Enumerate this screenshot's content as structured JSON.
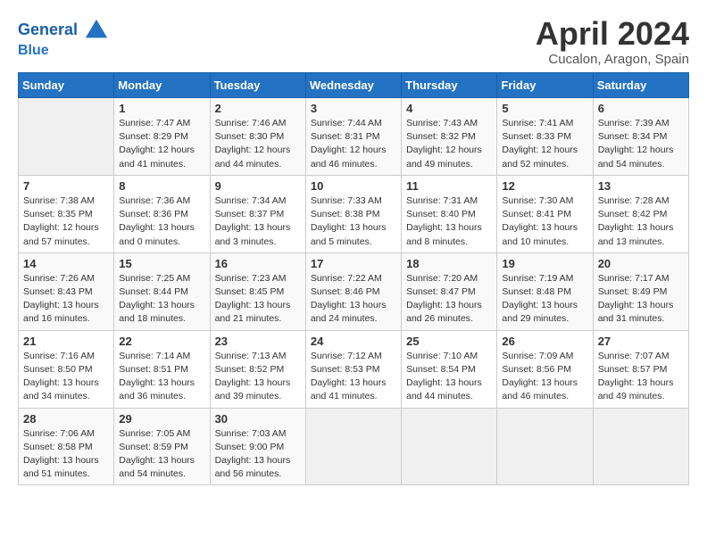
{
  "header": {
    "logo_line1": "General",
    "logo_line2": "Blue",
    "month_title": "April 2024",
    "location": "Cucalon, Aragon, Spain"
  },
  "weekdays": [
    "Sunday",
    "Monday",
    "Tuesday",
    "Wednesday",
    "Thursday",
    "Friday",
    "Saturday"
  ],
  "weeks": [
    [
      {
        "day": "",
        "empty": true
      },
      {
        "day": "1",
        "sunrise": "Sunrise: 7:47 AM",
        "sunset": "Sunset: 8:29 PM",
        "daylight": "Daylight: 12 hours and 41 minutes."
      },
      {
        "day": "2",
        "sunrise": "Sunrise: 7:46 AM",
        "sunset": "Sunset: 8:30 PM",
        "daylight": "Daylight: 12 hours and 44 minutes."
      },
      {
        "day": "3",
        "sunrise": "Sunrise: 7:44 AM",
        "sunset": "Sunset: 8:31 PM",
        "daylight": "Daylight: 12 hours and 46 minutes."
      },
      {
        "day": "4",
        "sunrise": "Sunrise: 7:43 AM",
        "sunset": "Sunset: 8:32 PM",
        "daylight": "Daylight: 12 hours and 49 minutes."
      },
      {
        "day": "5",
        "sunrise": "Sunrise: 7:41 AM",
        "sunset": "Sunset: 8:33 PM",
        "daylight": "Daylight: 12 hours and 52 minutes."
      },
      {
        "day": "6",
        "sunrise": "Sunrise: 7:39 AM",
        "sunset": "Sunset: 8:34 PM",
        "daylight": "Daylight: 12 hours and 54 minutes."
      }
    ],
    [
      {
        "day": "7",
        "sunrise": "Sunrise: 7:38 AM",
        "sunset": "Sunset: 8:35 PM",
        "daylight": "Daylight: 12 hours and 57 minutes."
      },
      {
        "day": "8",
        "sunrise": "Sunrise: 7:36 AM",
        "sunset": "Sunset: 8:36 PM",
        "daylight": "Daylight: 13 hours and 0 minutes."
      },
      {
        "day": "9",
        "sunrise": "Sunrise: 7:34 AM",
        "sunset": "Sunset: 8:37 PM",
        "daylight": "Daylight: 13 hours and 3 minutes."
      },
      {
        "day": "10",
        "sunrise": "Sunrise: 7:33 AM",
        "sunset": "Sunset: 8:38 PM",
        "daylight": "Daylight: 13 hours and 5 minutes."
      },
      {
        "day": "11",
        "sunrise": "Sunrise: 7:31 AM",
        "sunset": "Sunset: 8:40 PM",
        "daylight": "Daylight: 13 hours and 8 minutes."
      },
      {
        "day": "12",
        "sunrise": "Sunrise: 7:30 AM",
        "sunset": "Sunset: 8:41 PM",
        "daylight": "Daylight: 13 hours and 10 minutes."
      },
      {
        "day": "13",
        "sunrise": "Sunrise: 7:28 AM",
        "sunset": "Sunset: 8:42 PM",
        "daylight": "Daylight: 13 hours and 13 minutes."
      }
    ],
    [
      {
        "day": "14",
        "sunrise": "Sunrise: 7:26 AM",
        "sunset": "Sunset: 8:43 PM",
        "daylight": "Daylight: 13 hours and 16 minutes."
      },
      {
        "day": "15",
        "sunrise": "Sunrise: 7:25 AM",
        "sunset": "Sunset: 8:44 PM",
        "daylight": "Daylight: 13 hours and 18 minutes."
      },
      {
        "day": "16",
        "sunrise": "Sunrise: 7:23 AM",
        "sunset": "Sunset: 8:45 PM",
        "daylight": "Daylight: 13 hours and 21 minutes."
      },
      {
        "day": "17",
        "sunrise": "Sunrise: 7:22 AM",
        "sunset": "Sunset: 8:46 PM",
        "daylight": "Daylight: 13 hours and 24 minutes."
      },
      {
        "day": "18",
        "sunrise": "Sunrise: 7:20 AM",
        "sunset": "Sunset: 8:47 PM",
        "daylight": "Daylight: 13 hours and 26 minutes."
      },
      {
        "day": "19",
        "sunrise": "Sunrise: 7:19 AM",
        "sunset": "Sunset: 8:48 PM",
        "daylight": "Daylight: 13 hours and 29 minutes."
      },
      {
        "day": "20",
        "sunrise": "Sunrise: 7:17 AM",
        "sunset": "Sunset: 8:49 PM",
        "daylight": "Daylight: 13 hours and 31 minutes."
      }
    ],
    [
      {
        "day": "21",
        "sunrise": "Sunrise: 7:16 AM",
        "sunset": "Sunset: 8:50 PM",
        "daylight": "Daylight: 13 hours and 34 minutes."
      },
      {
        "day": "22",
        "sunrise": "Sunrise: 7:14 AM",
        "sunset": "Sunset: 8:51 PM",
        "daylight": "Daylight: 13 hours and 36 minutes."
      },
      {
        "day": "23",
        "sunrise": "Sunrise: 7:13 AM",
        "sunset": "Sunset: 8:52 PM",
        "daylight": "Daylight: 13 hours and 39 minutes."
      },
      {
        "day": "24",
        "sunrise": "Sunrise: 7:12 AM",
        "sunset": "Sunset: 8:53 PM",
        "daylight": "Daylight: 13 hours and 41 minutes."
      },
      {
        "day": "25",
        "sunrise": "Sunrise: 7:10 AM",
        "sunset": "Sunset: 8:54 PM",
        "daylight": "Daylight: 13 hours and 44 minutes."
      },
      {
        "day": "26",
        "sunrise": "Sunrise: 7:09 AM",
        "sunset": "Sunset: 8:56 PM",
        "daylight": "Daylight: 13 hours and 46 minutes."
      },
      {
        "day": "27",
        "sunrise": "Sunrise: 7:07 AM",
        "sunset": "Sunset: 8:57 PM",
        "daylight": "Daylight: 13 hours and 49 minutes."
      }
    ],
    [
      {
        "day": "28",
        "sunrise": "Sunrise: 7:06 AM",
        "sunset": "Sunset: 8:58 PM",
        "daylight": "Daylight: 13 hours and 51 minutes."
      },
      {
        "day": "29",
        "sunrise": "Sunrise: 7:05 AM",
        "sunset": "Sunset: 8:59 PM",
        "daylight": "Daylight: 13 hours and 54 minutes."
      },
      {
        "day": "30",
        "sunrise": "Sunrise: 7:03 AM",
        "sunset": "Sunset: 9:00 PM",
        "daylight": "Daylight: 13 hours and 56 minutes."
      },
      {
        "day": "",
        "empty": true
      },
      {
        "day": "",
        "empty": true
      },
      {
        "day": "",
        "empty": true
      },
      {
        "day": "",
        "empty": true
      }
    ]
  ]
}
